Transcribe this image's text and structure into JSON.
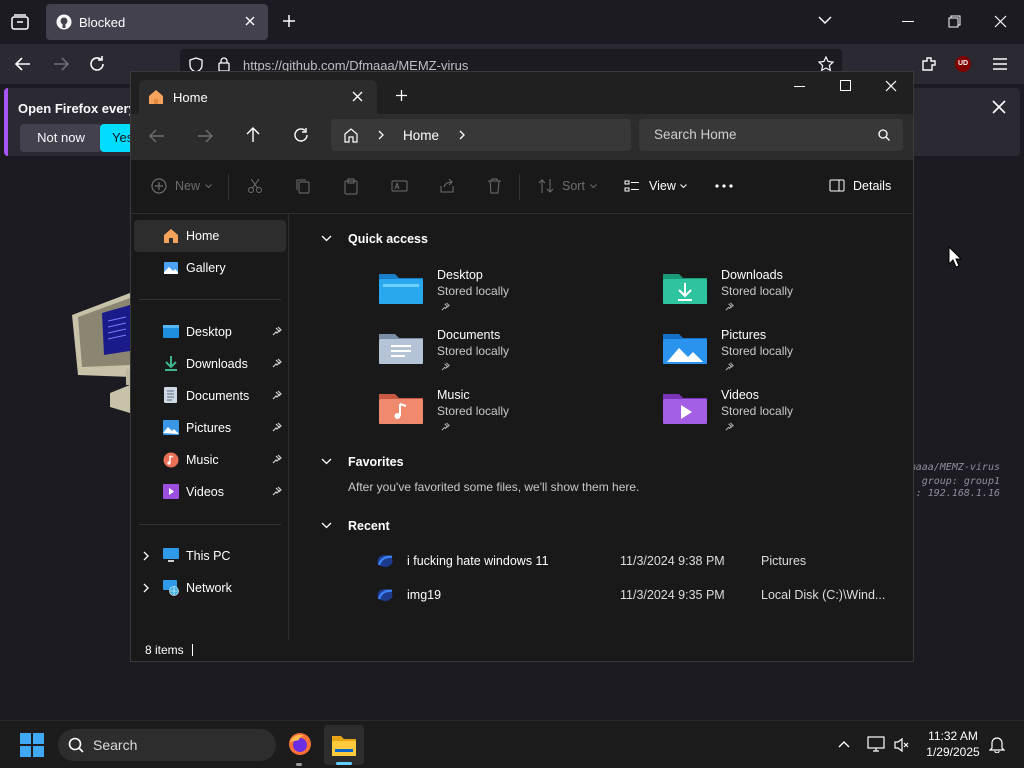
{
  "firefox": {
    "tab_title": "Blocked",
    "url": "https://github.com/Dfmaaa/MEMZ-virus",
    "notification_text": "Open Firefox every",
    "notification_btn_no": "Not now",
    "notification_btn_yes": "Yes,",
    "addon_badge": "UD",
    "terminal_lines": [
      "maaa/MEMZ-virus",
      "group: group1",
      ": 192.168.1.16"
    ]
  },
  "explorer": {
    "tab_title": "Home",
    "breadcrumb": "Home",
    "search_placeholder": "Search Home",
    "cmd": {
      "new": "New",
      "sort": "Sort",
      "view": "View",
      "details": "Details"
    },
    "sidebar": {
      "top": [
        {
          "label": "Home",
          "icon": "home-icon"
        },
        {
          "label": "Gallery",
          "icon": "gallery-icon"
        }
      ],
      "pinned": [
        {
          "label": "Desktop",
          "icon": "desktop-folder-icon"
        },
        {
          "label": "Downloads",
          "icon": "downloads-folder-icon"
        },
        {
          "label": "Documents",
          "icon": "documents-folder-icon"
        },
        {
          "label": "Pictures",
          "icon": "pictures-folder-icon"
        },
        {
          "label": "Music",
          "icon": "music-folder-icon"
        },
        {
          "label": "Videos",
          "icon": "videos-folder-icon"
        }
      ],
      "bottom": [
        {
          "label": "This PC",
          "icon": "pc-icon"
        },
        {
          "label": "Network",
          "icon": "network-icon"
        }
      ]
    },
    "quick_access": {
      "header": "Quick access",
      "items": [
        {
          "name": "Desktop",
          "sub": "Stored locally"
        },
        {
          "name": "Downloads",
          "sub": "Stored locally"
        },
        {
          "name": "Documents",
          "sub": "Stored locally"
        },
        {
          "name": "Pictures",
          "sub": "Stored locally"
        },
        {
          "name": "Music",
          "sub": "Stored locally"
        },
        {
          "name": "Videos",
          "sub": "Stored locally"
        }
      ]
    },
    "favorites": {
      "header": "Favorites",
      "empty_text": "After you've favorited some files, we'll show them here."
    },
    "recent": {
      "header": "Recent",
      "items": [
        {
          "name": "i fucking hate windows 11",
          "date": "11/3/2024 9:38 PM",
          "location": "Pictures"
        },
        {
          "name": "img19",
          "date": "11/3/2024 9:35 PM",
          "location": "Local Disk (C:)\\Wind..."
        }
      ]
    },
    "status": "8 items"
  },
  "taskbar": {
    "search": "Search",
    "time": "11:32 AM",
    "date": "1/29/2025"
  },
  "colors": {
    "accent_cyan": "#00ddff",
    "firefox_purple": "#a855f7",
    "ublock_red": "#800000"
  }
}
